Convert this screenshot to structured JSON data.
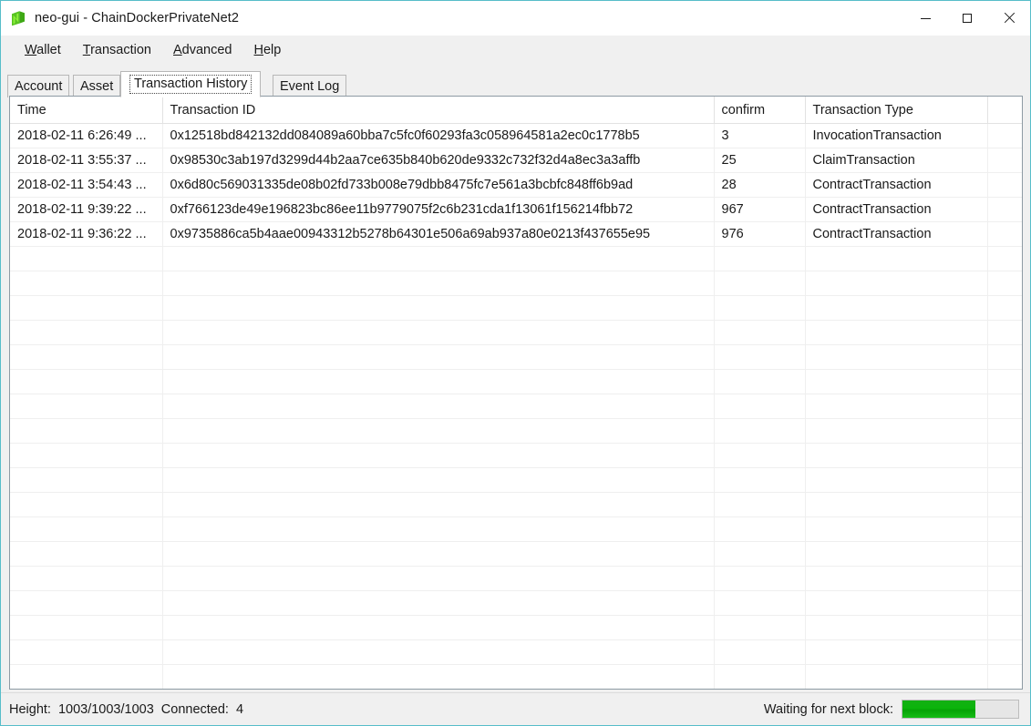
{
  "window": {
    "title": "neo-gui - ChainDockerPrivateNet2",
    "icon": "neo-logo-icon",
    "accent_border": "#57bdc9",
    "controls": {
      "minimize": "minimize-icon",
      "maximize": "maximize-icon",
      "close": "close-icon"
    }
  },
  "menubar": {
    "items": [
      {
        "mnemonic": "W",
        "rest": "allet"
      },
      {
        "mnemonic": "T",
        "rest": "ransaction"
      },
      {
        "mnemonic": "A",
        "rest": "dvanced"
      },
      {
        "mnemonic": "H",
        "rest": "elp"
      }
    ]
  },
  "tabs": {
    "selected": "Transaction History",
    "items": [
      {
        "label": "Account",
        "selected": false
      },
      {
        "label": "Asset",
        "selected": false
      },
      {
        "label": "Transaction History",
        "selected": true
      },
      {
        "label": "Event Log",
        "selected": false
      }
    ]
  },
  "table": {
    "columns": [
      "Time",
      "Transaction ID",
      "confirm",
      "Transaction Type",
      ""
    ],
    "rows": [
      {
        "time": "2018-02-11 6:26:49 ...",
        "txid": "0x12518bd842132dd084089a60bba7c5fc0f60293fa3c058964581a2ec0c1778b5",
        "confirm": "3",
        "type": "InvocationTransaction"
      },
      {
        "time": "2018-02-11 3:55:37 ...",
        "txid": "0x98530c3ab197d3299d44b2aa7ce635b840b620de9332c732f32d4a8ec3a3affb",
        "confirm": "25",
        "type": "ClaimTransaction"
      },
      {
        "time": "2018-02-11 3:54:43 ...",
        "txid": "0x6d80c569031335de08b02fd733b008e79dbb8475fc7e561a3bcbfc848ff6b9ad",
        "confirm": "28",
        "type": "ContractTransaction"
      },
      {
        "time": "2018-02-11 9:39:22 ...",
        "txid": "0xf766123de49e196823bc86ee11b9779075f2c6b231cda1f13061f156214fbb72",
        "confirm": "967",
        "type": "ContractTransaction"
      },
      {
        "time": "2018-02-11 9:36:22 ...",
        "txid": "0x9735886ca5b4aae00943312b5278b64301e506a69ab937a80e0213f437655e95",
        "confirm": "976",
        "type": "ContractTransaction"
      }
    ],
    "empty_row_count": 19
  },
  "statusbar": {
    "height_label": "Height:",
    "height_value": "1003/1003/1003",
    "connected_label": "Connected:",
    "connected_value": "4",
    "waiting_label": "Waiting for next block:",
    "progress_percent": 63,
    "progress_color": "#0bb40b"
  }
}
